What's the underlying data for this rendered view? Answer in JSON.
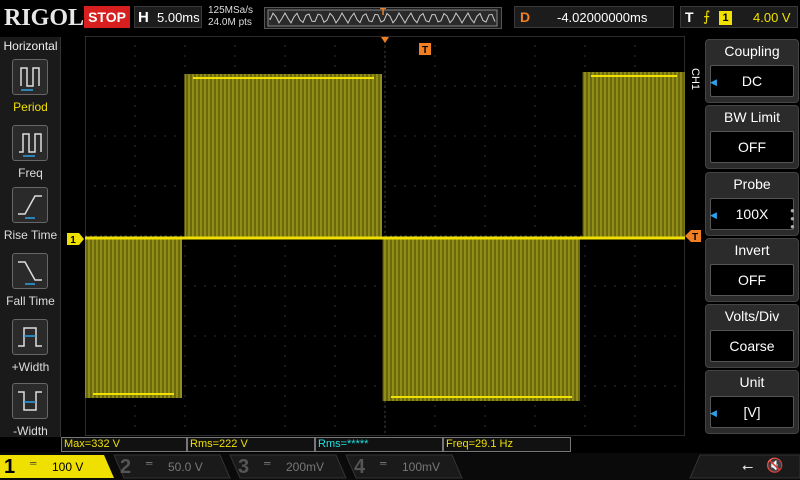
{
  "header": {
    "logo": "RIGOL",
    "run_state": "STOP",
    "timebase_label": "H",
    "timebase_value": "5.00ms",
    "sample_rate": "125MSa/s",
    "memory_depth": "24.0M pts",
    "trigger_marker": "T",
    "delay_label": "D",
    "delay_value": "-4.02000000ms",
    "trigger_label": "T",
    "trigger_source": "1",
    "trigger_level": "4.00 V"
  },
  "left_menu": {
    "title": "Horizontal",
    "items": [
      {
        "label": "Period",
        "icon": "period-icon"
      },
      {
        "label": "Freq",
        "icon": "frequency-icon"
      },
      {
        "label": "Rise Time",
        "icon": "rise-time-icon"
      },
      {
        "label": "Fall Time",
        "icon": "fall-time-icon"
      },
      {
        "label": "+Width",
        "icon": "positive-width-icon"
      },
      {
        "label": "-Width",
        "icon": "negative-width-icon"
      }
    ]
  },
  "grid": {
    "trigger_marker": "T",
    "channel_marker": "1",
    "trigger_level_marker": "T"
  },
  "right_menu": {
    "channel_tab": "CH1",
    "buttons": [
      {
        "title": "Coupling",
        "value": "DC"
      },
      {
        "title": "BW Limit",
        "value": "OFF"
      },
      {
        "title": "Probe",
        "value": "100X"
      },
      {
        "title": "Invert",
        "value": "OFF"
      },
      {
        "title": "Volts/Div",
        "value": "Coarse"
      },
      {
        "title": "Unit",
        "value": "[V]"
      }
    ]
  },
  "measurements": [
    {
      "text": "Max=332 V"
    },
    {
      "text": "Rms=222 V"
    },
    {
      "text": "Rms=*****"
    },
    {
      "text": "Freq=29.1 Hz"
    }
  ],
  "channels": [
    {
      "num": "1",
      "value": "100 V",
      "color": "#f0e000"
    },
    {
      "num": "2",
      "value": "50.0 V",
      "color": "#1fe0e0"
    },
    {
      "num": "3",
      "value": "200mV",
      "color": "#e040e0"
    },
    {
      "num": "4",
      "value": "100mV",
      "color": "#2e9fe8"
    }
  ],
  "colors": {
    "ch1": "#f0e000",
    "trigger": "#f07f23",
    "stop": "#d81f1f",
    "waveform_fill": "#7a7a10"
  }
}
